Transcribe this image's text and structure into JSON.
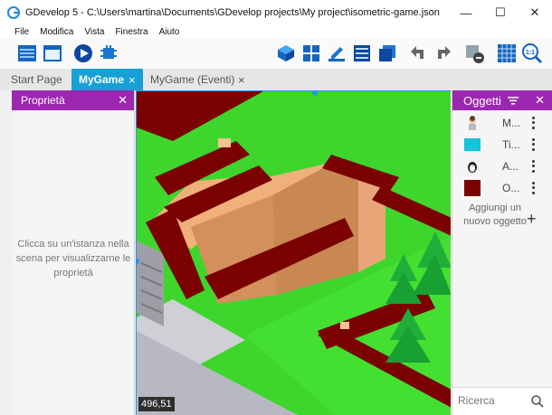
{
  "window": {
    "title": "GDevelop 5 - C:\\Users\\martina\\Documents\\GDevelop projects\\My project\\isometric-game.json"
  },
  "menu": {
    "items": [
      "File",
      "Modifica",
      "Vista",
      "Finestra",
      "Aiuto"
    ]
  },
  "tabs": {
    "start": "Start Page",
    "mygame": "MyGame",
    "events": "MyGame (Eventi)",
    "close_glyph": "×"
  },
  "left_panel": {
    "title": "Proprietà",
    "empty_message": "Clicca su un'istanza nella scena per visualizzarne le proprietà"
  },
  "scene": {
    "coords": "496,51"
  },
  "objects_panel": {
    "title": "Oggetti",
    "items": [
      {
        "name": "M...",
        "thumb": "character-icon"
      },
      {
        "name": "Ti...",
        "thumb": "cyan-tile"
      },
      {
        "name": "A...",
        "thumb": "penguin-icon"
      },
      {
        "name": "O...",
        "thumb": "dark-red-tile"
      }
    ],
    "add_label": "Aggiungi un nuovo oggetto",
    "add_glyph": "+",
    "search_placeholder": "Ricerca"
  },
  "colors": {
    "accent": "#18a0d6",
    "panel_header": "#9c27b0",
    "grass": "#3ed62c",
    "wall": "#7b0000",
    "sand": "#e0a877"
  }
}
